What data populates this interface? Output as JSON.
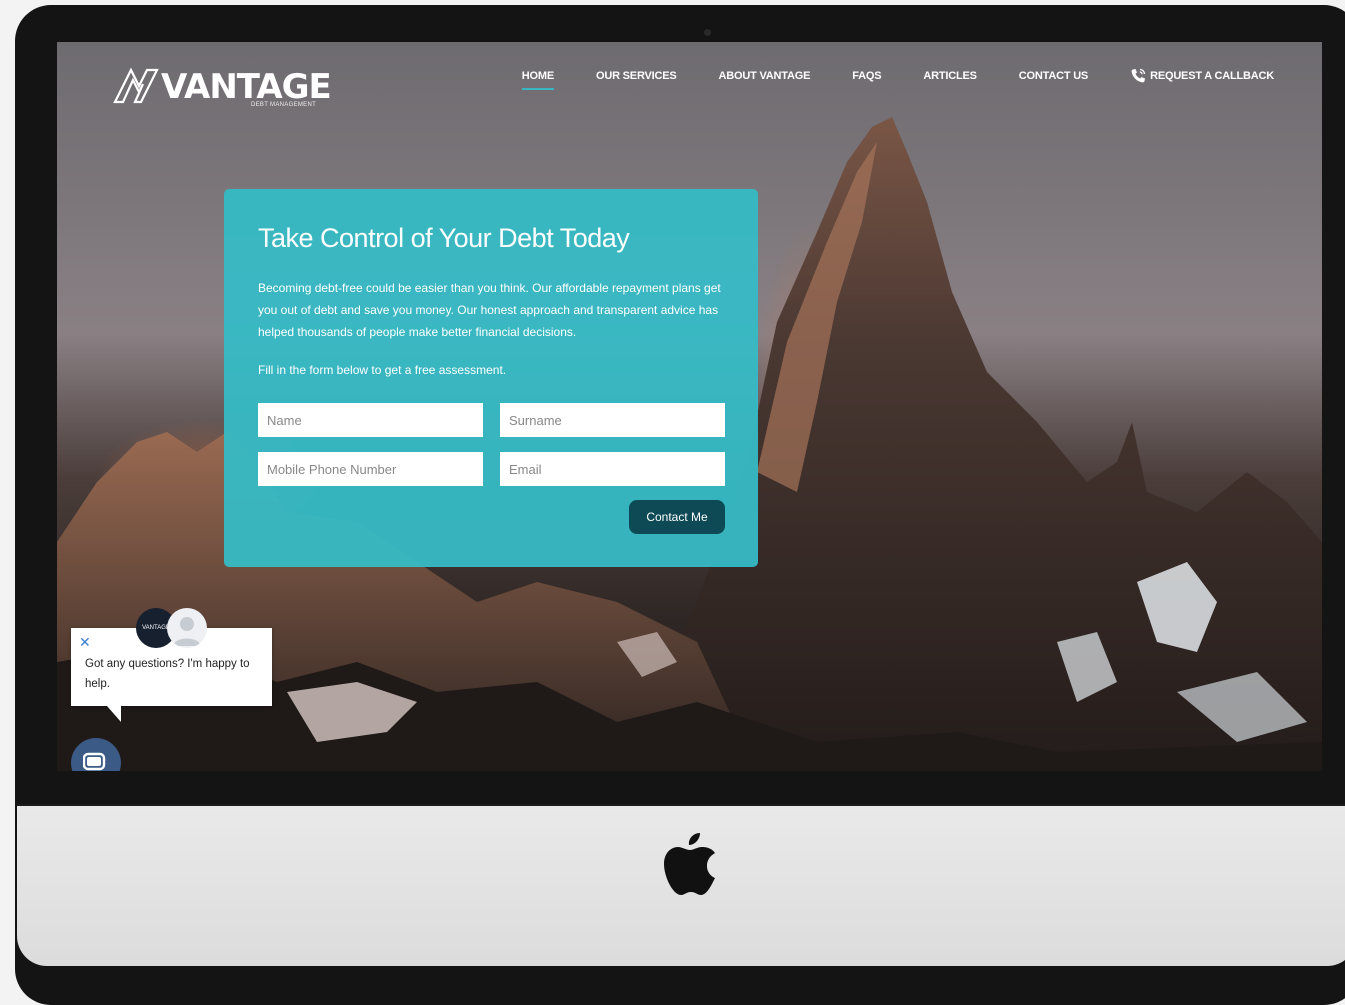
{
  "brand": {
    "name": "VANTAGE",
    "tagline": "DEBT MANAGEMENT"
  },
  "nav": {
    "items": [
      {
        "label": "HOME",
        "active": true
      },
      {
        "label": "OUR SERVICES"
      },
      {
        "label": "ABOUT VANTAGE"
      },
      {
        "label": "FAQS"
      },
      {
        "label": "ARTICLES"
      },
      {
        "label": "CONTACT US"
      }
    ],
    "callback_label": "REQUEST A CALLBACK",
    "callback_icon": "phone-icon"
  },
  "hero": {
    "title": "Take Control of Your Debt Today",
    "body": "Becoming debt-free could be easier than you think. Our affordable repayment plans get you out of debt and save you money. Our honest approach and transparent advice has helped thousands of people make better financial decisions.",
    "prompt": "Fill in the form below to get a free assessment.",
    "form": {
      "name_placeholder": "Name",
      "surname_placeholder": "Surname",
      "mobile_placeholder": "Mobile Phone Number",
      "email_placeholder": "Email",
      "submit_label": "Contact Me"
    }
  },
  "chat": {
    "message": "Got any questions? I'm happy to help.",
    "close_icon": "close-icon",
    "brand_avatar_label": "VANTAGE"
  },
  "colors": {
    "card": "#36bac5",
    "button": "#0d4a55",
    "nav_active_underline": "#3ab6c3",
    "chat_launcher": "#3b5a86"
  }
}
